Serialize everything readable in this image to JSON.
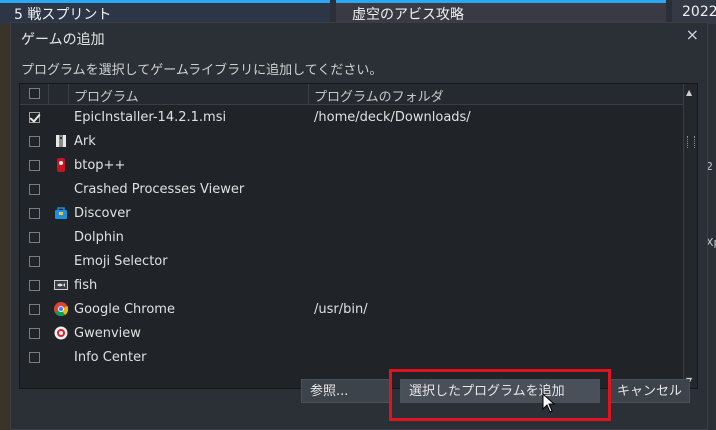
{
  "background": {
    "tile1_title": "5 戦スプリント",
    "tile2_title": "虚空のアビス攻略",
    "tile3_title": "2022",
    "right_edge_text1": "2",
    "right_edge_text2": "Xp"
  },
  "dialog": {
    "title": "ゲームの追加",
    "close": "×",
    "instruction": "プログラムを選択してゲームライブラリに追加してください。",
    "columns": {
      "program": "プログラム",
      "folder": "プログラムのフォルダ"
    },
    "rows": [
      {
        "name": "EpicInstaller-14.2.1.msi",
        "folder": "/home/deck/Downloads/",
        "checked": true,
        "icon": "none"
      },
      {
        "name": "Ark",
        "folder": "",
        "checked": false,
        "icon": "ark-icon"
      },
      {
        "name": "btop++",
        "folder": "",
        "checked": false,
        "icon": "btop-icon"
      },
      {
        "name": "Crashed Processes Viewer",
        "folder": "",
        "checked": false,
        "icon": "none"
      },
      {
        "name": "Discover",
        "folder": "",
        "checked": false,
        "icon": "discover-icon"
      },
      {
        "name": "Dolphin",
        "folder": "",
        "checked": false,
        "icon": "none"
      },
      {
        "name": "Emoji Selector",
        "folder": "",
        "checked": false,
        "icon": "none"
      },
      {
        "name": "fish",
        "folder": "",
        "checked": false,
        "icon": "fish-icon"
      },
      {
        "name": "Google Chrome",
        "folder": "/usr/bin/",
        "checked": false,
        "icon": "chrome-icon"
      },
      {
        "name": "Gwenview",
        "folder": "",
        "checked": false,
        "icon": "gwenview-icon"
      },
      {
        "name": "Info Center",
        "folder": "",
        "checked": false,
        "icon": "none"
      }
    ],
    "buttons": {
      "browse": "参照...",
      "add_selected": "選択したプログラムを追加",
      "cancel": "キャンセル"
    }
  },
  "colors": {
    "highlight": "#e0141e",
    "accent": "#2aa8f2"
  }
}
